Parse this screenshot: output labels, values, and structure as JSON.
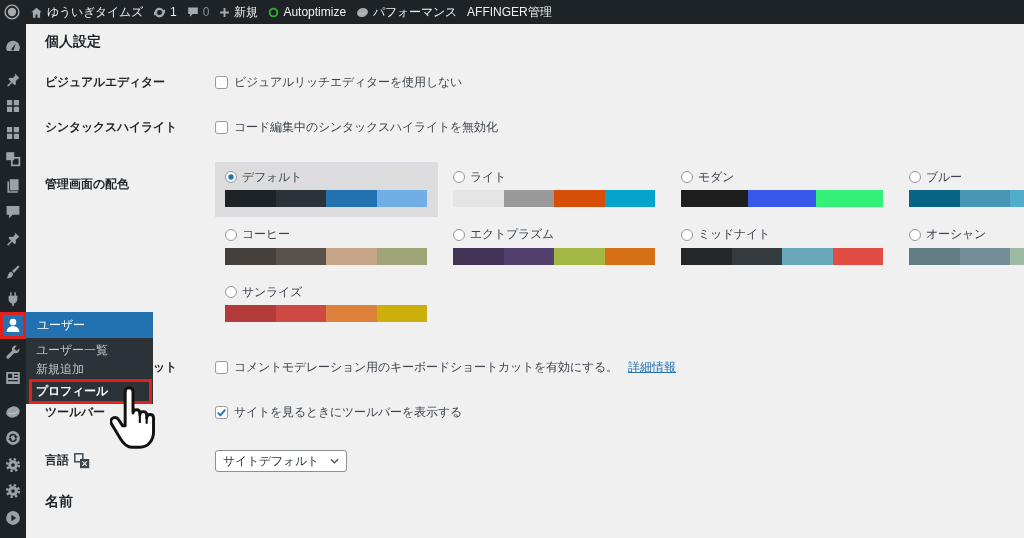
{
  "admin_bar": {
    "items": [
      {
        "kind": "logo"
      },
      {
        "kind": "site",
        "label": "ゆういぎタイムズ"
      },
      {
        "kind": "updates",
        "label": "1"
      },
      {
        "kind": "comments",
        "label": "0"
      },
      {
        "kind": "new",
        "label": "新規"
      },
      {
        "kind": "status",
        "label": "Autoptimize"
      },
      {
        "kind": "performance",
        "label": "パフォーマンス"
      },
      {
        "kind": "plain",
        "label": "AFFINGER管理"
      }
    ]
  },
  "sidebar": {
    "groups": [
      {
        "items": [
          {
            "kind": "dashboard",
            "selected": false,
            "highlighted": false
          }
        ]
      },
      {
        "items": [
          {
            "kind": "posts",
            "selected": false,
            "highlighted": false
          },
          {
            "kind": "blocks",
            "selected": false,
            "highlighted": false
          },
          {
            "kind": "patterns",
            "selected": false,
            "highlighted": false
          },
          {
            "kind": "media",
            "selected": false,
            "highlighted": false
          },
          {
            "kind": "pages",
            "selected": false,
            "highlighted": false
          },
          {
            "kind": "comments",
            "selected": false,
            "highlighted": false
          },
          {
            "kind": "custom_posts",
            "selected": false,
            "highlighted": false
          }
        ]
      },
      {
        "items": [
          {
            "kind": "appearance",
            "selected": false,
            "highlighted": false
          },
          {
            "kind": "plugins",
            "selected": false,
            "highlighted": false
          },
          {
            "kind": "users",
            "selected": true,
            "highlighted": true
          },
          {
            "kind": "tools",
            "selected": false,
            "highlighted": false
          },
          {
            "kind": "layout",
            "selected": false,
            "highlighted": false
          }
        ]
      },
      {
        "items": [
          {
            "kind": "performance",
            "selected": false,
            "highlighted": false
          },
          {
            "kind": "sync",
            "selected": false,
            "highlighted": false
          },
          {
            "kind": "settings",
            "selected": false,
            "highlighted": false
          },
          {
            "kind": "settings",
            "selected": false,
            "highlighted": false
          },
          {
            "kind": "video",
            "selected": false,
            "highlighted": false
          }
        ]
      }
    ]
  },
  "flyout": {
    "title": "ユーザー",
    "items": [
      {
        "label": "ユーザー一覧",
        "selected": false,
        "highlighted": false
      },
      {
        "label": "新規追加",
        "selected": false,
        "highlighted": false
      },
      {
        "label": "プロフィール",
        "selected": true,
        "highlighted": true
      }
    ]
  },
  "pointer": {
    "kind": "hand"
  },
  "page_title": "個人設定",
  "settings": [
    {
      "kind": "checkbox",
      "label": "ビジュアルエディター",
      "checked": false,
      "text": "ビジュアルリッチエディターを使用しない"
    },
    {
      "kind": "checkbox",
      "label": "シンタックスハイライト",
      "checked": false,
      "text": "コード編集中のシンタックスハイライトを無効化"
    },
    {
      "kind": "color_scheme",
      "label": "管理画面の配色",
      "schemes": [
        {
          "name": "デフォルト",
          "selected": true,
          "swatches": [
            {
              "color": "#1d2327"
            },
            {
              "color": "#2c3338"
            },
            {
              "color": "#2271b1"
            },
            {
              "color": "#72aee6"
            }
          ]
        },
        {
          "name": "ライト",
          "selected": false,
          "swatches": [
            {
              "color": "#e5e5e5"
            },
            {
              "color": "#999999"
            },
            {
              "color": "#d64e07"
            },
            {
              "color": "#04a4cc"
            }
          ]
        },
        {
          "name": "モダン",
          "selected": false,
          "swatches": [
            {
              "color": "#1e1e1e"
            },
            {
              "color": "#3858e9"
            },
            {
              "color": "#33f078"
            }
          ]
        },
        {
          "name": "ブルー",
          "selected": false,
          "swatches": [
            {
              "color": "#096484"
            },
            {
              "color": "#4796b3"
            },
            {
              "color": "#52accc"
            }
          ]
        },
        {
          "name": "コーヒー",
          "selected": false,
          "swatches": [
            {
              "color": "#46403c"
            },
            {
              "color": "#59524c"
            },
            {
              "color": "#c7a589"
            },
            {
              "color": "#9ea476"
            }
          ]
        },
        {
          "name": "エクトプラズム",
          "selected": false,
          "swatches": [
            {
              "color": "#413256"
            },
            {
              "color": "#523f6d"
            },
            {
              "color": "#a3b745"
            },
            {
              "color": "#d46f15"
            }
          ]
        },
        {
          "name": "ミッドナイト",
          "selected": false,
          "swatches": [
            {
              "color": "#25282b"
            },
            {
              "color": "#363b3f"
            },
            {
              "color": "#69a8bb"
            },
            {
              "color": "#e14d43"
            }
          ]
        },
        {
          "name": "オーシャン",
          "selected": false,
          "swatches": [
            {
              "color": "#627c83"
            },
            {
              "color": "#738e96"
            },
            {
              "color": "#9ebaa0"
            }
          ]
        },
        {
          "name": "サンライズ",
          "selected": false,
          "swatches": [
            {
              "color": "#b43c38"
            },
            {
              "color": "#cf4944"
            },
            {
              "color": "#dd823b"
            },
            {
              "color": "#ccaf0b"
            }
          ]
        }
      ]
    },
    {
      "kind": "checkbox",
      "label": "ット",
      "label_clipped": true,
      "checked": false,
      "text": "コメントモデレーション用のキーボードショートカットを有効にする。",
      "link": "詳細情報"
    },
    {
      "kind": "checkbox",
      "label": "ツールバー",
      "checked": true,
      "text": "サイトを見るときにツールバーを表示する"
    },
    {
      "kind": "language",
      "label": "言語",
      "value": "サイトデフォルト"
    }
  ],
  "section_title": "名前"
}
